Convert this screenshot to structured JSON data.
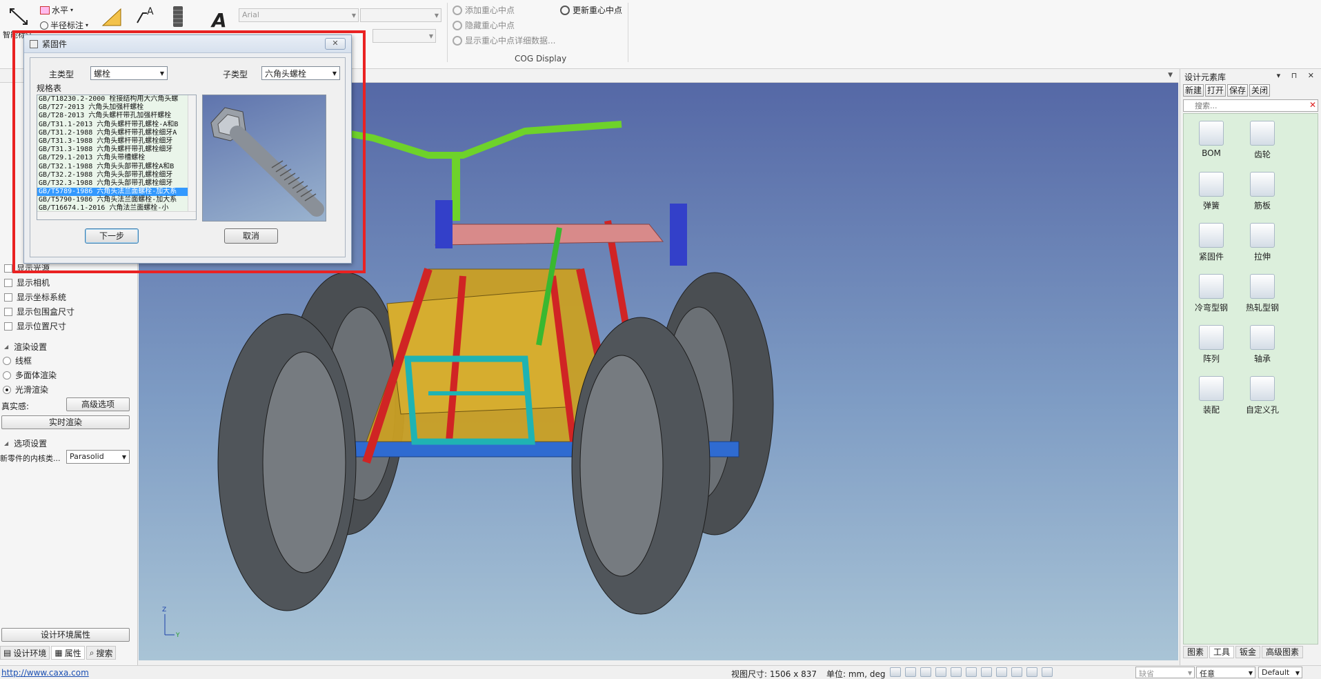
{
  "ribbon": {
    "smart_label": "智能标注",
    "horizontal_label": "水平",
    "radius_label": "半径标注",
    "font_name": "Arial",
    "cog_items": [
      "添加重心中点",
      "隐藏重心中点",
      "显示重心中点详细数据..."
    ],
    "cog_update": "更新重心中点",
    "cog_group": "COG Display"
  },
  "left_panel": {
    "checks": [
      "显示光源",
      "显示相机",
      "显示坐标系统",
      "显示包围盒尺寸",
      "显示位置尺寸"
    ],
    "render_header": "渲染设置",
    "render_options": [
      "线框",
      "多面体渲染",
      "光滑渲染"
    ],
    "render_selected": "光滑渲染",
    "realism_label": "真实感:",
    "advanced_btn": "高级选项",
    "realtime_btn": "实时渲染",
    "options_header": "选项设置",
    "kernel_label": "新零件的内核类...",
    "kernel_value": "Parasolid",
    "design_env_btn": "设计环境属性",
    "tabs": [
      "设计环境",
      "属性",
      "搜索"
    ]
  },
  "dialog": {
    "title": "紧固件",
    "main_type_label": "主类型",
    "main_type_value": "螺栓",
    "sub_type_label": "子类型",
    "sub_type_value": "六角头螺栓",
    "spec_table_label": "规格表",
    "spec_items": [
      "GB/T18230.2-2000 栓接结构用大六角头螺",
      "GB/T27-2013 六角头加强杆螺栓",
      "GB/T28-2013 六角头螺杆带孔加强杆螺栓",
      "GB/T31.1-2013 六角头螺杆带孔螺栓-A和B",
      "GB/T31.2-1988 六角头螺杆带孔螺栓细牙A",
      "GB/T31.3-1988 六角头螺杆带孔螺栓细牙",
      "GB/T31.3-1988 六角头螺杆带孔螺栓细牙",
      "GB/T29.1-2013 六角头带槽螺栓",
      "GB/T32.1-1988 六角头头部带孔螺栓A和B",
      "GB/T32.2-1988 六角头头部带孔螺栓细牙",
      "GB/T32.3-1988 六角头头部带孔螺栓细牙",
      "GB/T5789-1986 六角头法兰面螺栓-加大系",
      "GB/T5790-1986 六角头法兰面螺栓-加大系",
      "GB/T16674.1-2016 六角法兰面螺栓-小"
    ],
    "selected_index": 11,
    "next_btn": "下一步",
    "cancel_btn": "取消"
  },
  "right_panel": {
    "title": "设计元素库",
    "toolbar": [
      "新建",
      "打开",
      "保存",
      "关闭"
    ],
    "search_placeholder": "搜索...",
    "items": [
      "BOM",
      "齿轮",
      "弹簧",
      "筋板",
      "紧固件",
      "拉伸",
      "冷弯型钢",
      "热轧型钢",
      "阵列",
      "轴承",
      "装配",
      "自定义孔"
    ],
    "tabs": [
      "图素",
      "工具",
      "钣金",
      "高级图素"
    ],
    "active_tab": "工具"
  },
  "status": {
    "url": "http://www.caxa.com",
    "view_size": "视图尺寸: 1506 x 837",
    "units": "单位: mm, deg",
    "select1": "缺省",
    "select2": "任意",
    "select3": "Default"
  },
  "colors": {
    "highlight_red": "#ea2222",
    "list_selection": "#3399ff",
    "library_bg": "#dcefdc"
  }
}
